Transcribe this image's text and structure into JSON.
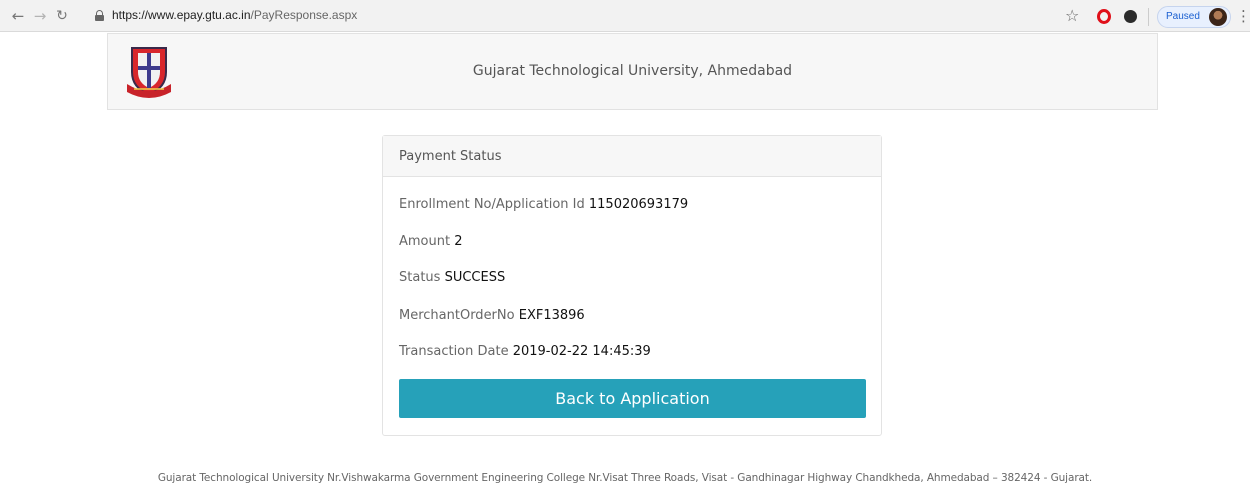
{
  "browser": {
    "url_host": "https://www.epay.gtu.ac.in",
    "url_path": "/PayResponse.aspx",
    "paused_label": "Paused",
    "icons": [
      "back-icon",
      "forward-icon",
      "reload-icon",
      "lock-icon",
      "star-icon",
      "opera-icon",
      "extension-icon",
      "avatar",
      "menu-icon"
    ]
  },
  "header": {
    "title": "Gujarat Technological University, Ahmedabad",
    "logo_icon": "university-crest-icon"
  },
  "payment": {
    "card_title": "Payment Status",
    "fields": {
      "enrollment_label": "Enrollment No/Application Id",
      "enrollment_value": "115020693179",
      "amount_label": "Amount",
      "amount_value": "2",
      "status_label": "Status",
      "status_value": "SUCCESS",
      "merchant_label": "MerchantOrderNo",
      "merchant_value": "EXF13896",
      "date_label": "Transaction Date",
      "date_value": "2019-02-22 14:45:39"
    },
    "back_button_label": "Back to Application"
  },
  "footer": {
    "text": "Gujarat Technological University Nr.Vishwakarma Government Engineering College Nr.Visat Three Roads, Visat - Gandhinagar Highway Chandkheda, Ahmedabad – 382424 - Gujarat."
  },
  "colors": {
    "button": "#26a1b9",
    "header_bg": "#f7f7f7",
    "opera_red": "#e0101a"
  }
}
